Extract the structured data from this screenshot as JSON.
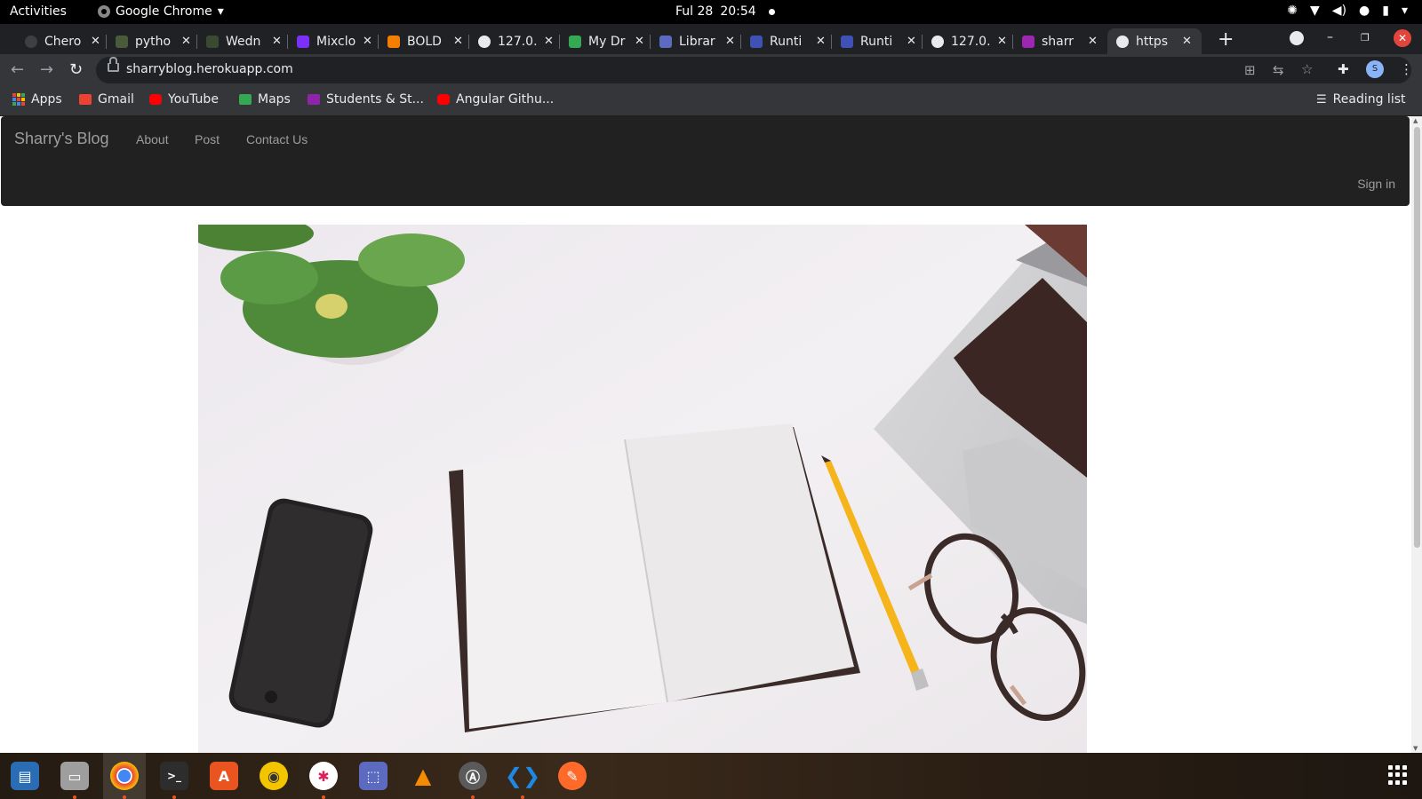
{
  "system_bar": {
    "activities": "Activities",
    "app_menu": "Google Chrome",
    "date": "Ful 28",
    "time": "20:54"
  },
  "tabs": [
    {
      "title": "Chero",
      "favicon_color": "#3c4043"
    },
    {
      "title": "pytho",
      "favicon_color": "#4a5b3a"
    },
    {
      "title": "Wedn",
      "favicon_color": "#3a4a30"
    },
    {
      "title": "Mixclo",
      "favicon_color": "#7b2ff7"
    },
    {
      "title": "BOLD",
      "favicon_color": "#f57d00"
    },
    {
      "title": "127.0.",
      "favicon_color": "#e8eaed"
    },
    {
      "title": "My Dr",
      "favicon_color": "#34a853"
    },
    {
      "title": "Librar",
      "favicon_color": "#5c6bc0"
    },
    {
      "title": "Runti",
      "favicon_color": "#3f51b5"
    },
    {
      "title": "Runti",
      "favicon_color": "#3f51b5"
    },
    {
      "title": "127.0.",
      "favicon_color": "#e8eaed"
    },
    {
      "title": "sharr",
      "favicon_color": "#9c27b0"
    },
    {
      "title": "https",
      "favicon_color": "#e8eaed",
      "active": true
    }
  ],
  "omnibox": {
    "url": "sharryblog.herokuapp.com"
  },
  "profile_initial": "S",
  "bookmarks": [
    {
      "label": "Apps"
    },
    {
      "label": "Gmail"
    },
    {
      "label": "YouTube"
    },
    {
      "label": "Maps"
    },
    {
      "label": "Students & St..."
    },
    {
      "label": "Angular Githu..."
    }
  ],
  "reading_list": "Reading list",
  "site": {
    "brand": "Sharry's Blog",
    "nav": [
      "About",
      "Post",
      "Contact Us"
    ],
    "sign_in": "Sign in"
  },
  "dock": [
    {
      "name": "libreoffice-writer",
      "color": "#2a6db5"
    },
    {
      "name": "files",
      "color": "#9e9e9e"
    },
    {
      "name": "google-chrome",
      "color": "#ffffff"
    },
    {
      "name": "terminal",
      "color": "#2d2d2d"
    },
    {
      "name": "software-center",
      "color": "#e95420"
    },
    {
      "name": "rhythmbox",
      "color": "#f2c500"
    },
    {
      "name": "slack",
      "color": "#ffffff"
    },
    {
      "name": "screenshot",
      "color": "#5c6bc0"
    },
    {
      "name": "vlc",
      "color": "#f48b00"
    },
    {
      "name": "software-updater",
      "color": "#5a5a5a"
    },
    {
      "name": "vscode",
      "color": "#1e88e5"
    },
    {
      "name": "inkscape",
      "color": "#ff6a2b"
    }
  ]
}
